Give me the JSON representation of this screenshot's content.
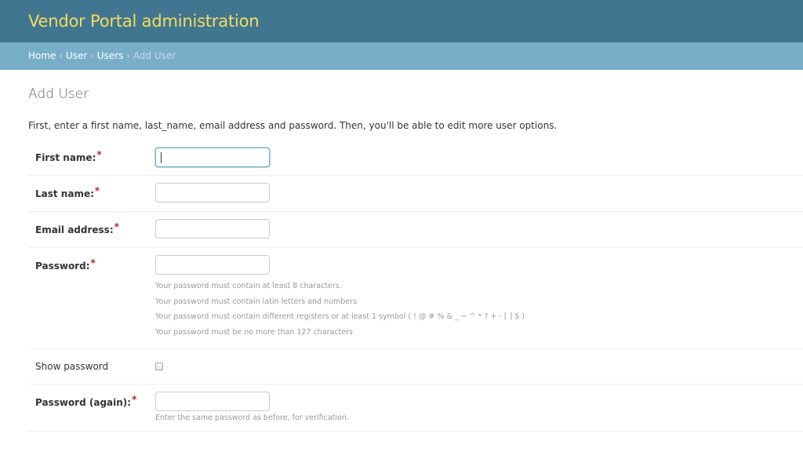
{
  "header": {
    "site_title": "Vendor Portal administration"
  },
  "breadcrumbs": {
    "home": "Home",
    "app": "User",
    "model": "Users",
    "current": "Add User",
    "separator": "›"
  },
  "page": {
    "title": "Add User",
    "intro": "First, enter a first name, last_name, email address and password. Then, you'll be able to edit more user options."
  },
  "form": {
    "first_name": {
      "label": "First name:",
      "value": ""
    },
    "last_name": {
      "label": "Last name:",
      "value": ""
    },
    "email": {
      "label": "Email address:",
      "value": ""
    },
    "password": {
      "label": "Password:",
      "value": "",
      "help": [
        "Your password must contain at least 8 characters.",
        "Your password must contain latin letters and numbers",
        "Your password must contain different registers or at least 1 symbol ( ! @ # % & _ ~ ^ * ? + - [ ] $ )",
        "Your password must be no more than 127 characters"
      ]
    },
    "show_password": {
      "label": "Show password",
      "checked": false
    },
    "password_again": {
      "label": "Password (again):",
      "value": "",
      "help": "Enter the same password as before, for verification."
    },
    "required_marker": "*"
  },
  "colors": {
    "header_bg": "#417690",
    "site_title": "#f5dd5d",
    "breadcrumbs_bg": "#79aec8",
    "required_star": "#ba2121"
  }
}
